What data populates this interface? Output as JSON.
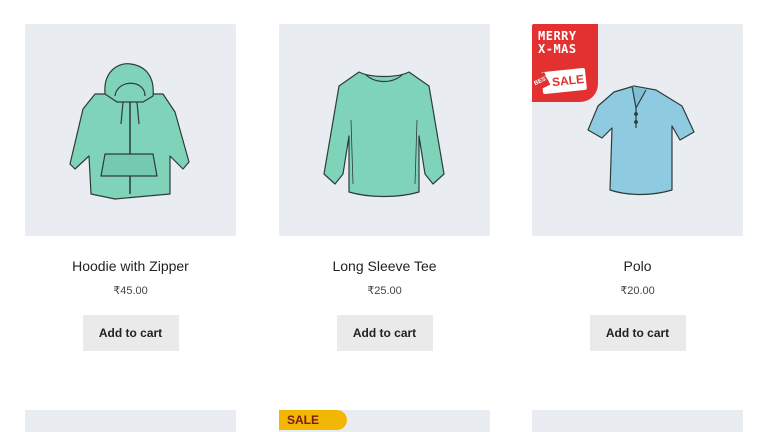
{
  "products": [
    {
      "name": "Hoodie with Zipper",
      "price": "₹45.00",
      "button": "Add to cart",
      "thumb_color": "#e9edf2",
      "icon": "hoodie-illustration"
    },
    {
      "name": "Long Sleeve Tee",
      "price": "₹25.00",
      "button": "Add to cart",
      "thumb_color": "#e9edf2",
      "icon": "long-sleeve-tee-illustration"
    },
    {
      "name": "Polo",
      "price": "₹20.00",
      "button": "Add to cart",
      "thumb_color": "#e9edf2",
      "icon": "polo-illustration",
      "badge": {
        "line1": "MERRY",
        "line2": "X-MAS",
        "small": "BEST",
        "sale": "SALE"
      }
    }
  ],
  "row2": {
    "sale_badge": "SALE",
    "badge_color": "#f2b705"
  },
  "colors": {
    "garment_green": "#7fd3b8",
    "polo_blue": "#8fcbe0",
    "button_bg": "#eaeaea",
    "ribbon_red": "#e33131"
  }
}
